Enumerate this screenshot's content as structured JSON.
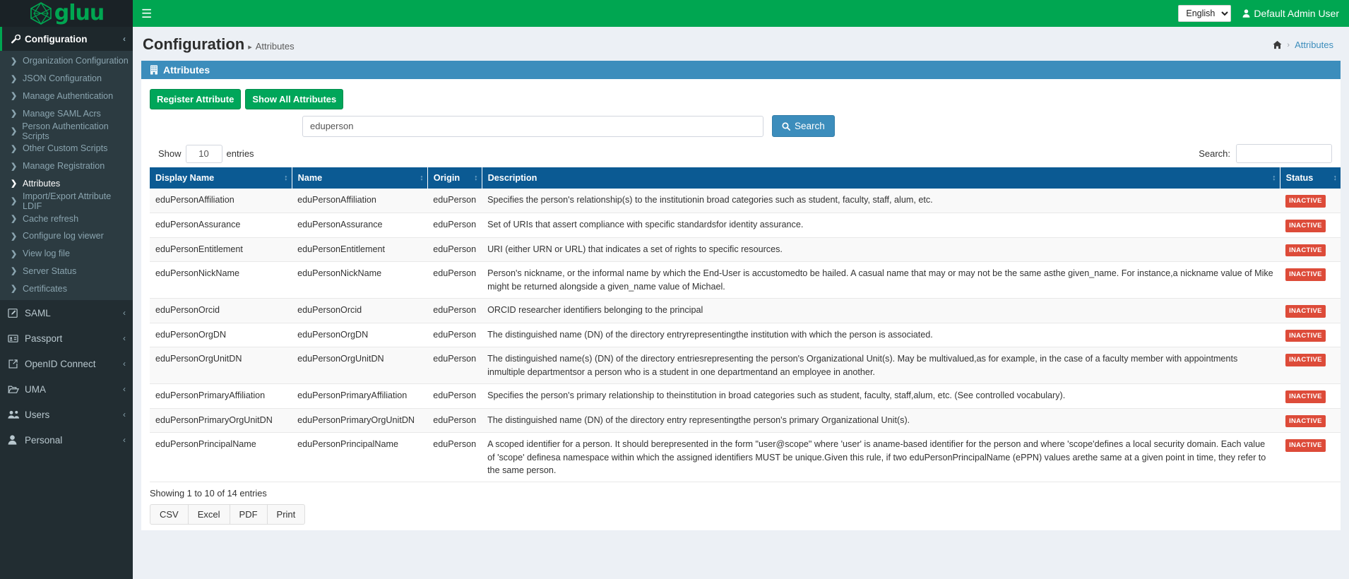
{
  "brand": {
    "name": "gluu",
    "accent": "#00a651"
  },
  "topbar": {
    "menu_icon": "hamburger-icon",
    "language": "English",
    "language_options": [
      "English"
    ],
    "user": "Default Admin User"
  },
  "sidebar": {
    "section": {
      "icon": "wrench-icon",
      "label": "Configuration",
      "caret": "‹"
    },
    "sub_items": [
      {
        "label": "Organization Configuration",
        "active": false
      },
      {
        "label": "JSON Configuration",
        "active": false
      },
      {
        "label": "Manage Authentication",
        "active": false
      },
      {
        "label": "Manage SAML Acrs",
        "active": false
      },
      {
        "label": "Person Authentication Scripts",
        "active": false
      },
      {
        "label": "Other Custom Scripts",
        "active": false
      },
      {
        "label": "Manage Registration",
        "active": false
      },
      {
        "label": "Attributes",
        "active": true
      },
      {
        "label": "Import/Export Attribute LDIF",
        "active": false
      },
      {
        "label": "Cache refresh",
        "active": false
      },
      {
        "label": "Configure log viewer",
        "active": false
      },
      {
        "label": "View log file",
        "active": false
      },
      {
        "label": "Server Status",
        "active": false
      },
      {
        "label": "Certificates",
        "active": false
      }
    ],
    "nav_items": [
      {
        "icon": "edit-square-icon",
        "label": "SAML",
        "caret": "‹"
      },
      {
        "icon": "id-card-icon",
        "label": "Passport",
        "caret": "‹"
      },
      {
        "icon": "external-link-icon",
        "label": "OpenID Connect",
        "caret": "‹"
      },
      {
        "icon": "folder-open-icon",
        "label": "UMA",
        "caret": "‹"
      },
      {
        "icon": "users-icon",
        "label": "Users",
        "caret": "‹"
      },
      {
        "icon": "user-icon",
        "label": "Personal",
        "caret": "‹"
      }
    ]
  },
  "page": {
    "title": "Configuration",
    "subtitle": "Attributes",
    "breadcrumb": {
      "home_icon": "home-icon",
      "separator": "›",
      "current": "Attributes"
    }
  },
  "box": {
    "icon": "building-icon",
    "title": "Attributes",
    "buttons": {
      "register": "Register Attribute",
      "show_all": "Show All Attributes"
    },
    "search": {
      "value": "eduperson",
      "placeholder": "",
      "button_label": "Search",
      "button_icon": "search-icon"
    },
    "tools": {
      "show_label": "Show",
      "entries_value": "10",
      "entries_label": "entries",
      "filter_label": "Search:",
      "filter_value": "",
      "filter_placeholder": ""
    },
    "table": {
      "columns": [
        "Display Name",
        "Name",
        "Origin",
        "Description",
        "Status"
      ],
      "sort_icon": "sort-updown-icon",
      "rows": [
        {
          "display_name": "eduPersonAffiliation",
          "name": "eduPersonAffiliation",
          "origin": "eduPerson",
          "description": "Specifies the person's relationship(s) to the institutionin broad categories such as student, faculty, staff, alum, etc.",
          "status": "INACTIVE"
        },
        {
          "display_name": "eduPersonAssurance",
          "name": "eduPersonAssurance",
          "origin": "eduPerson",
          "description": "Set of URIs that assert compliance with specific standardsfor identity assurance.",
          "status": "INACTIVE"
        },
        {
          "display_name": "eduPersonEntitlement",
          "name": "eduPersonEntitlement",
          "origin": "eduPerson",
          "description": "URI (either URN or URL) that indicates a set of rights to specific resources.",
          "status": "INACTIVE"
        },
        {
          "display_name": "eduPersonNickName",
          "name": "eduPersonNickName",
          "origin": "eduPerson",
          "description": "Person's nickname, or the informal name by which the End-User is accustomedto be hailed. A casual name that may or may not be the same asthe given_name. For instance,a nickname value of Mike might be returned alongside a given_name value of Michael.",
          "status": "INACTIVE"
        },
        {
          "display_name": "eduPersonOrcid",
          "name": "eduPersonOrcid",
          "origin": "eduPerson",
          "description": "ORCID researcher identifiers belonging to the principal",
          "status": "INACTIVE"
        },
        {
          "display_name": "eduPersonOrgDN",
          "name": "eduPersonOrgDN",
          "origin": "eduPerson",
          "description": "The distinguished name (DN) of the directory entryrepresentingthe institution with which the person is associated.",
          "status": "INACTIVE"
        },
        {
          "display_name": "eduPersonOrgUnitDN",
          "name": "eduPersonOrgUnitDN",
          "origin": "eduPerson",
          "description": "The distinguished name(s) (DN) of the directory entriesrepresenting the person's Organizational Unit(s). May be multivalued,as for example, in the case of a faculty member with appointments inmultiple departmentsor a person who is a student in one departmentand an employee in another.",
          "status": "INACTIVE"
        },
        {
          "display_name": "eduPersonPrimaryAffiliation",
          "name": "eduPersonPrimaryAffiliation",
          "origin": "eduPerson",
          "description": "Specifies the person's primary relationship to theinstitution in broad categories such as student, faculty, staff,alum, etc. (See controlled vocabulary).",
          "status": "INACTIVE"
        },
        {
          "display_name": "eduPersonPrimaryOrgUnitDN",
          "name": "eduPersonPrimaryOrgUnitDN",
          "origin": "eduPerson",
          "description": "The distinguished name (DN) of the directory entry representingthe person's primary Organizational Unit(s).",
          "status": "INACTIVE"
        },
        {
          "display_name": "eduPersonPrincipalName",
          "name": "eduPersonPrincipalName",
          "origin": "eduPerson",
          "description": "A scoped identifier for a person. It should berepresented in the form \"user@scope\" where 'user' is aname-based identifier for the person and where 'scope'defines a local security domain. Each value of 'scope' definesa namespace within which the assigned identifiers MUST be unique.Given this rule, if two eduPersonPrincipalName (ePPN) values arethe same at a given point in time, they refer to the same person.",
          "status": "INACTIVE"
        }
      ]
    },
    "footer": {
      "info": "Showing 1 to 10 of 14 entries",
      "export_buttons": [
        "CSV",
        "Excel",
        "PDF",
        "Print"
      ]
    }
  }
}
